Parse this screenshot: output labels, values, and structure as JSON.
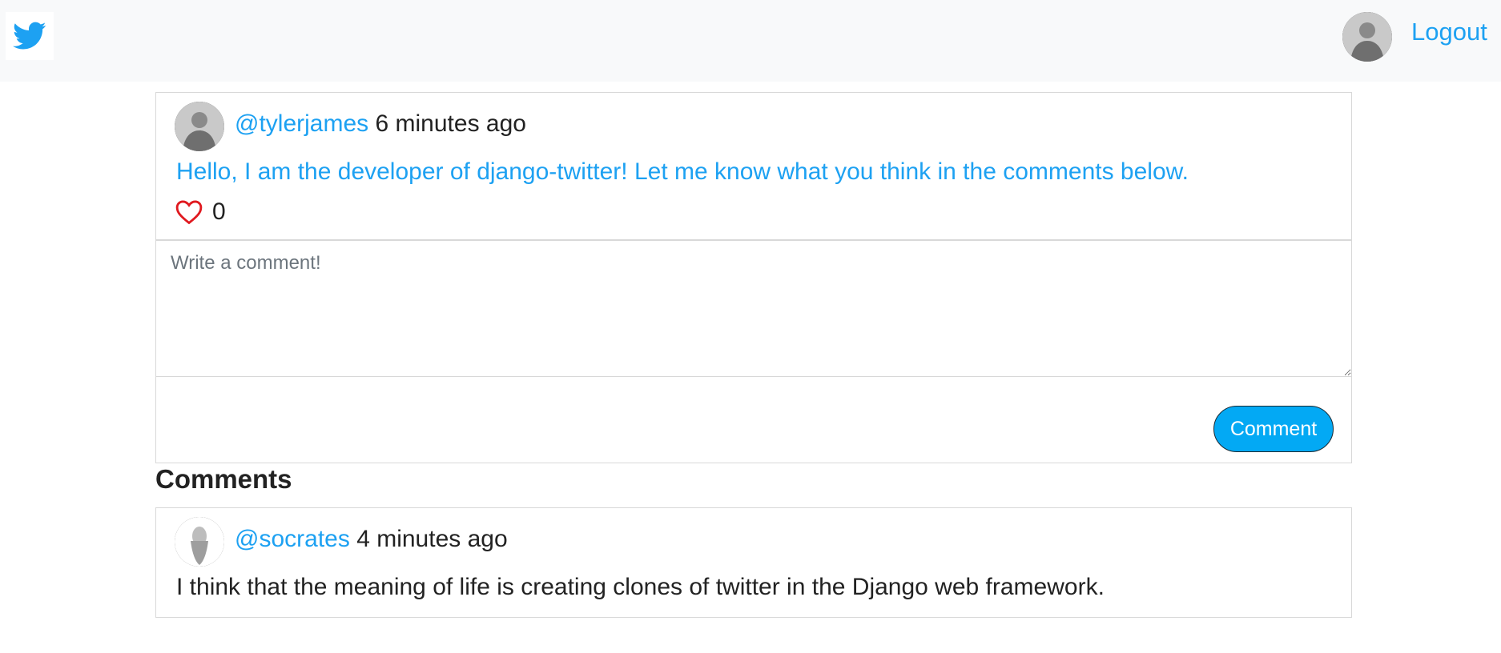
{
  "navbar": {
    "logo_icon": "twitter-bird-icon",
    "logout_label": "Logout",
    "brand_color": "#1da1f2"
  },
  "tweet": {
    "handle": "@tylerjames",
    "time": "6 minutes ago",
    "text": "Hello, I am the developer of django-twitter! Let me know what you think in the comments below.",
    "like_icon": "heart-outline-icon",
    "like_count": "0"
  },
  "comment_form": {
    "placeholder": "Write a comment!",
    "value": "",
    "submit_label": "Comment",
    "button_color": "#03a9f4"
  },
  "comments": {
    "title": "Comments",
    "items": [
      {
        "handle": "@socrates",
        "time": "4 minutes ago",
        "text": "I think that the meaning of life is creating clones of twitter in the Django web framework."
      }
    ]
  }
}
